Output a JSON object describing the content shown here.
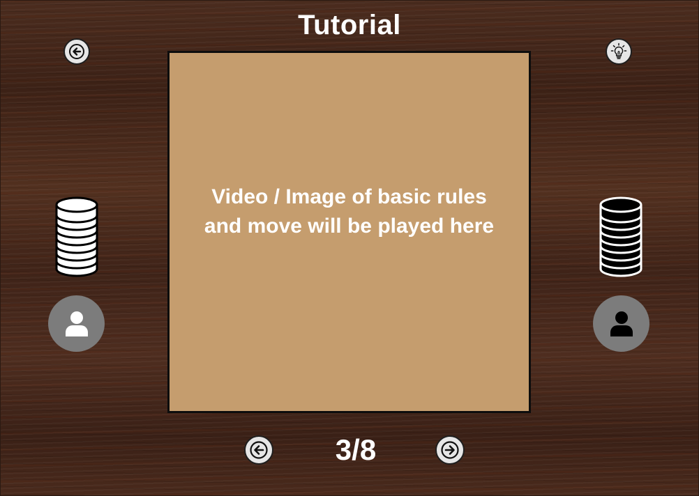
{
  "screen": {
    "title": "Tutorial"
  },
  "content": {
    "placeholder_line1": "Video / Image of basic rules",
    "placeholder_line2": "and move will be played here"
  },
  "pagination": {
    "indicator": "3/8",
    "current": 3,
    "total": 8
  },
  "icons": {
    "back": "arrow-left-icon",
    "hint": "lightbulb-icon",
    "prev": "arrow-left-icon",
    "next": "arrow-right-icon",
    "player_left": "user-icon",
    "player_right": "user-icon",
    "stack_left": "white-disc-stack-icon",
    "stack_right": "black-disc-stack-icon"
  },
  "colors": {
    "board": "#c59d6e",
    "board_border": "#0d0d0d",
    "button_bg": "#e6e6e6",
    "avatar_bg": "#7c7c7c",
    "text": "#ffffff",
    "player_left_color": "#ffffff",
    "player_right_color": "#000000"
  }
}
